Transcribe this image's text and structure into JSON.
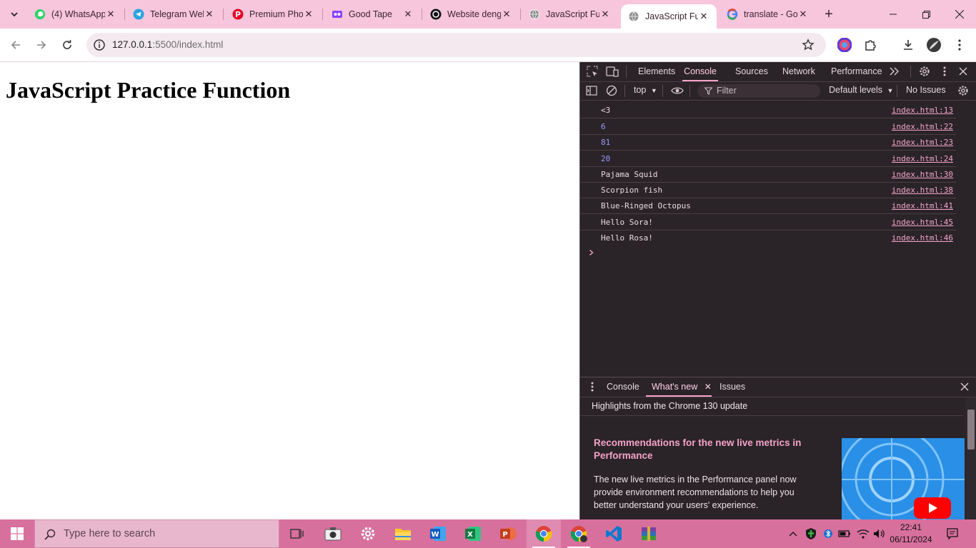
{
  "browser": {
    "tabs": [
      {
        "title": "(4) WhatsApp",
        "favicon": "whatsapp-icon",
        "active": false
      },
      {
        "title": "Telegram Web",
        "favicon": "telegram-icon",
        "active": false
      },
      {
        "title": "Premium Photo",
        "favicon": "pinterest-icon",
        "active": false
      },
      {
        "title": "Good Tape",
        "favicon": "goodtape-icon",
        "active": false
      },
      {
        "title": "Website dengan",
        "favicon": "chatgpt-icon",
        "active": false
      },
      {
        "title": "JavaScript Fu",
        "favicon": "globe-icon",
        "active": false
      },
      {
        "title": "JavaScript Fu",
        "favicon": "globe-icon",
        "active": true
      },
      {
        "title": "translate - Go",
        "favicon": "google-icon",
        "active": false
      }
    ],
    "url_host": "127.0.0.1",
    "url_rest": ":5500/index.html"
  },
  "page": {
    "heading": "JavaScript Practice Function"
  },
  "devtools": {
    "panels": [
      "Elements",
      "Console",
      "Sources",
      "Network",
      "Performance"
    ],
    "active_panel": "Console",
    "context": "top",
    "filter_placeholder": "Filter",
    "levels": "Default levels",
    "issues": "No Issues",
    "logs": [
      {
        "msg": "<3",
        "src": "index.html:13",
        "kind": "text"
      },
      {
        "msg": "6",
        "src": "index.html:22",
        "kind": "number"
      },
      {
        "msg": "81",
        "src": "index.html:23",
        "kind": "number"
      },
      {
        "msg": "20",
        "src": "index.html:24",
        "kind": "number"
      },
      {
        "msg": "Pajama Squid",
        "src": "index.html:30",
        "kind": "text"
      },
      {
        "msg": "Scorpion fish",
        "src": "index.html:38",
        "kind": "text"
      },
      {
        "msg": "Blue-Ringed Octopus",
        "src": "index.html:41",
        "kind": "text"
      },
      {
        "msg": "Hello Sora!",
        "src": "index.html:45",
        "kind": "text"
      },
      {
        "msg": "Hello Rosa!",
        "src": "index.html:46",
        "kind": "text"
      }
    ],
    "drawer": {
      "tabs": [
        "Console",
        "What's new",
        "Issues"
      ],
      "active_tab": "What's new",
      "highlight": "Highlights from the Chrome 130 update",
      "article_title": "Recommendations for the new live metrics in Performance",
      "article_body": "The new live metrics in the Performance panel now provide environment recommendations to help you better understand your users' experience."
    }
  },
  "taskbar": {
    "search_placeholder": "Type here to search",
    "time": "22:41",
    "date": "06/11/2024"
  }
}
